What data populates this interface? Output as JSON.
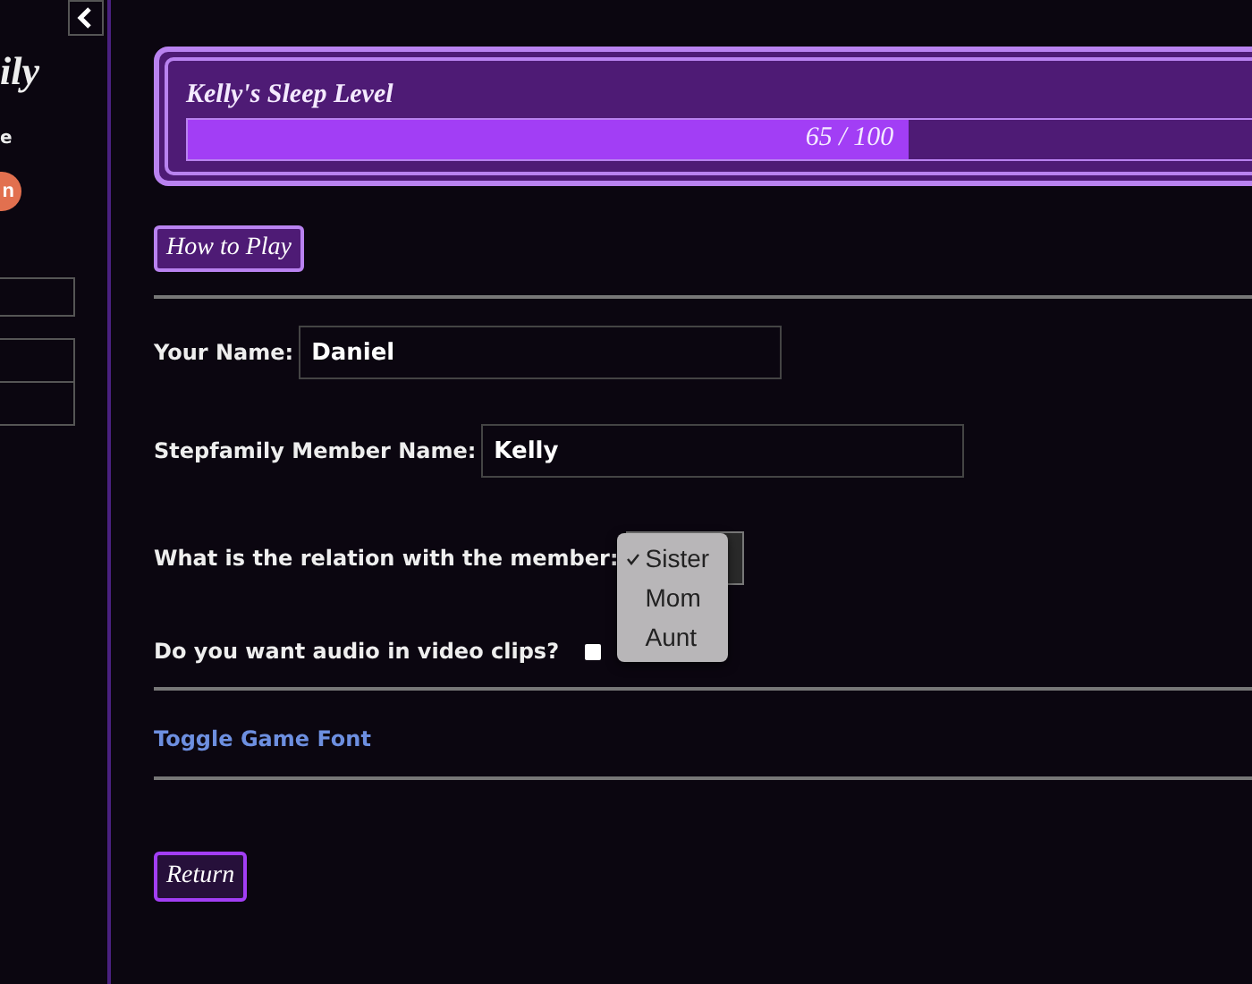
{
  "sidebar": {
    "title": "ily",
    "caption": "e",
    "button": "n"
  },
  "sleep_meter": {
    "title": "Kelly's Sleep Level",
    "level": 0.65,
    "reading": "65 / 100"
  },
  "how_to_play": "How to Play",
  "form": {
    "name": {
      "label": "Your Name:",
      "value": "Daniel"
    },
    "member": {
      "label": "Stepfamily Member Name:",
      "value": "Kelly"
    },
    "relation": {
      "label": "What is the relation with the member:",
      "expanded": true,
      "options": [
        {
          "label": "Sister",
          "selected": true
        },
        {
          "label": "Mom",
          "selected": false
        },
        {
          "label": "Aunt",
          "selected": false
        }
      ]
    },
    "audio": {
      "label": "Do you want audio in video clips?",
      "checked": false
    }
  },
  "toggle_font": "Toggle Game Font",
  "return_button": "Return"
}
